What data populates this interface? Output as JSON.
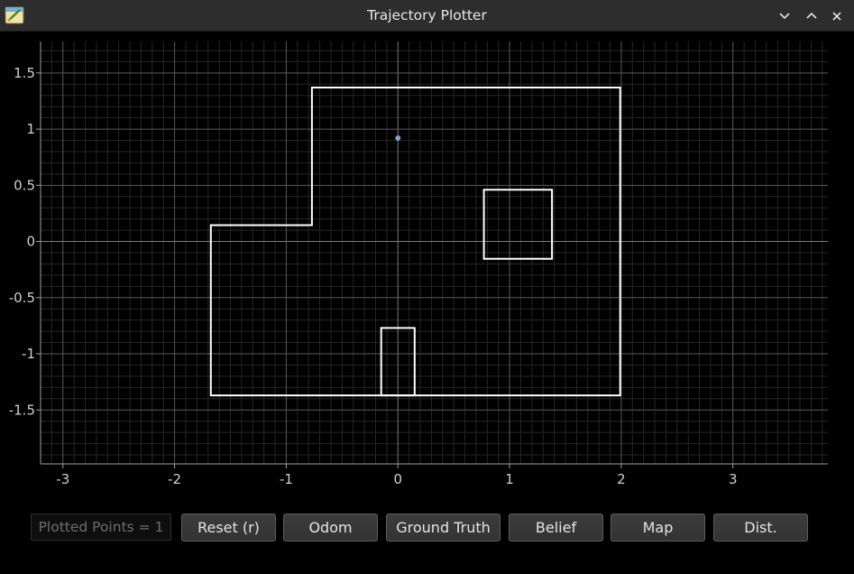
{
  "window": {
    "title": "Trajectory Plotter",
    "controls": [
      "minimize-icon",
      "maximize-icon"
    ]
  },
  "colors": {
    "background": "#000000",
    "titlebar": "#2d2d2d",
    "map_lines": "#ffffff",
    "point": "#7aa0d8",
    "grid_major": "#5a5a5a",
    "grid_minor": "#262626",
    "axis_zero": "#7a7a7a"
  },
  "chart_data": {
    "type": "scatter",
    "xlim": [
      -3.2,
      3.85
    ],
    "ylim": [
      -1.98,
      1.78
    ],
    "xticks": [
      -3,
      -2,
      -1,
      0,
      1,
      2,
      3
    ],
    "xtick_labels": [
      "-3",
      "-2",
      "-1",
      "0",
      "1",
      "2",
      "3"
    ],
    "yticks": [
      1.5,
      1,
      0.5,
      0,
      -0.5,
      -1,
      -1.5
    ],
    "ytick_labels": [
      "1.5",
      "1",
      "0.5",
      "0",
      "-0.5",
      "-1",
      "-1.5"
    ],
    "grid": true,
    "grid_minor_step": 0.1,
    "map_polygons": [
      [
        [
          -1.675,
          0.145
        ],
        [
          -0.77,
          0.145
        ],
        [
          -0.77,
          1.37
        ],
        [
          1.99,
          1.37
        ],
        [
          1.99,
          -1.37
        ],
        [
          -1.675,
          -1.37
        ]
      ],
      [
        [
          0.77,
          0.46
        ],
        [
          1.38,
          0.46
        ],
        [
          1.38,
          -0.155
        ],
        [
          0.77,
          -0.155
        ]
      ],
      [
        [
          -0.15,
          -0.77
        ],
        [
          0.15,
          -0.77
        ],
        [
          0.15,
          -1.37
        ],
        [
          -0.15,
          -1.37
        ]
      ]
    ],
    "points": [
      [
        0.0,
        0.92
      ]
    ]
  },
  "controls": {
    "plotted_points": "Plotted Points = 1",
    "buttons": [
      "Reset (r)",
      "Odom",
      "Ground Truth",
      "Belief",
      "Map",
      "Dist."
    ]
  }
}
